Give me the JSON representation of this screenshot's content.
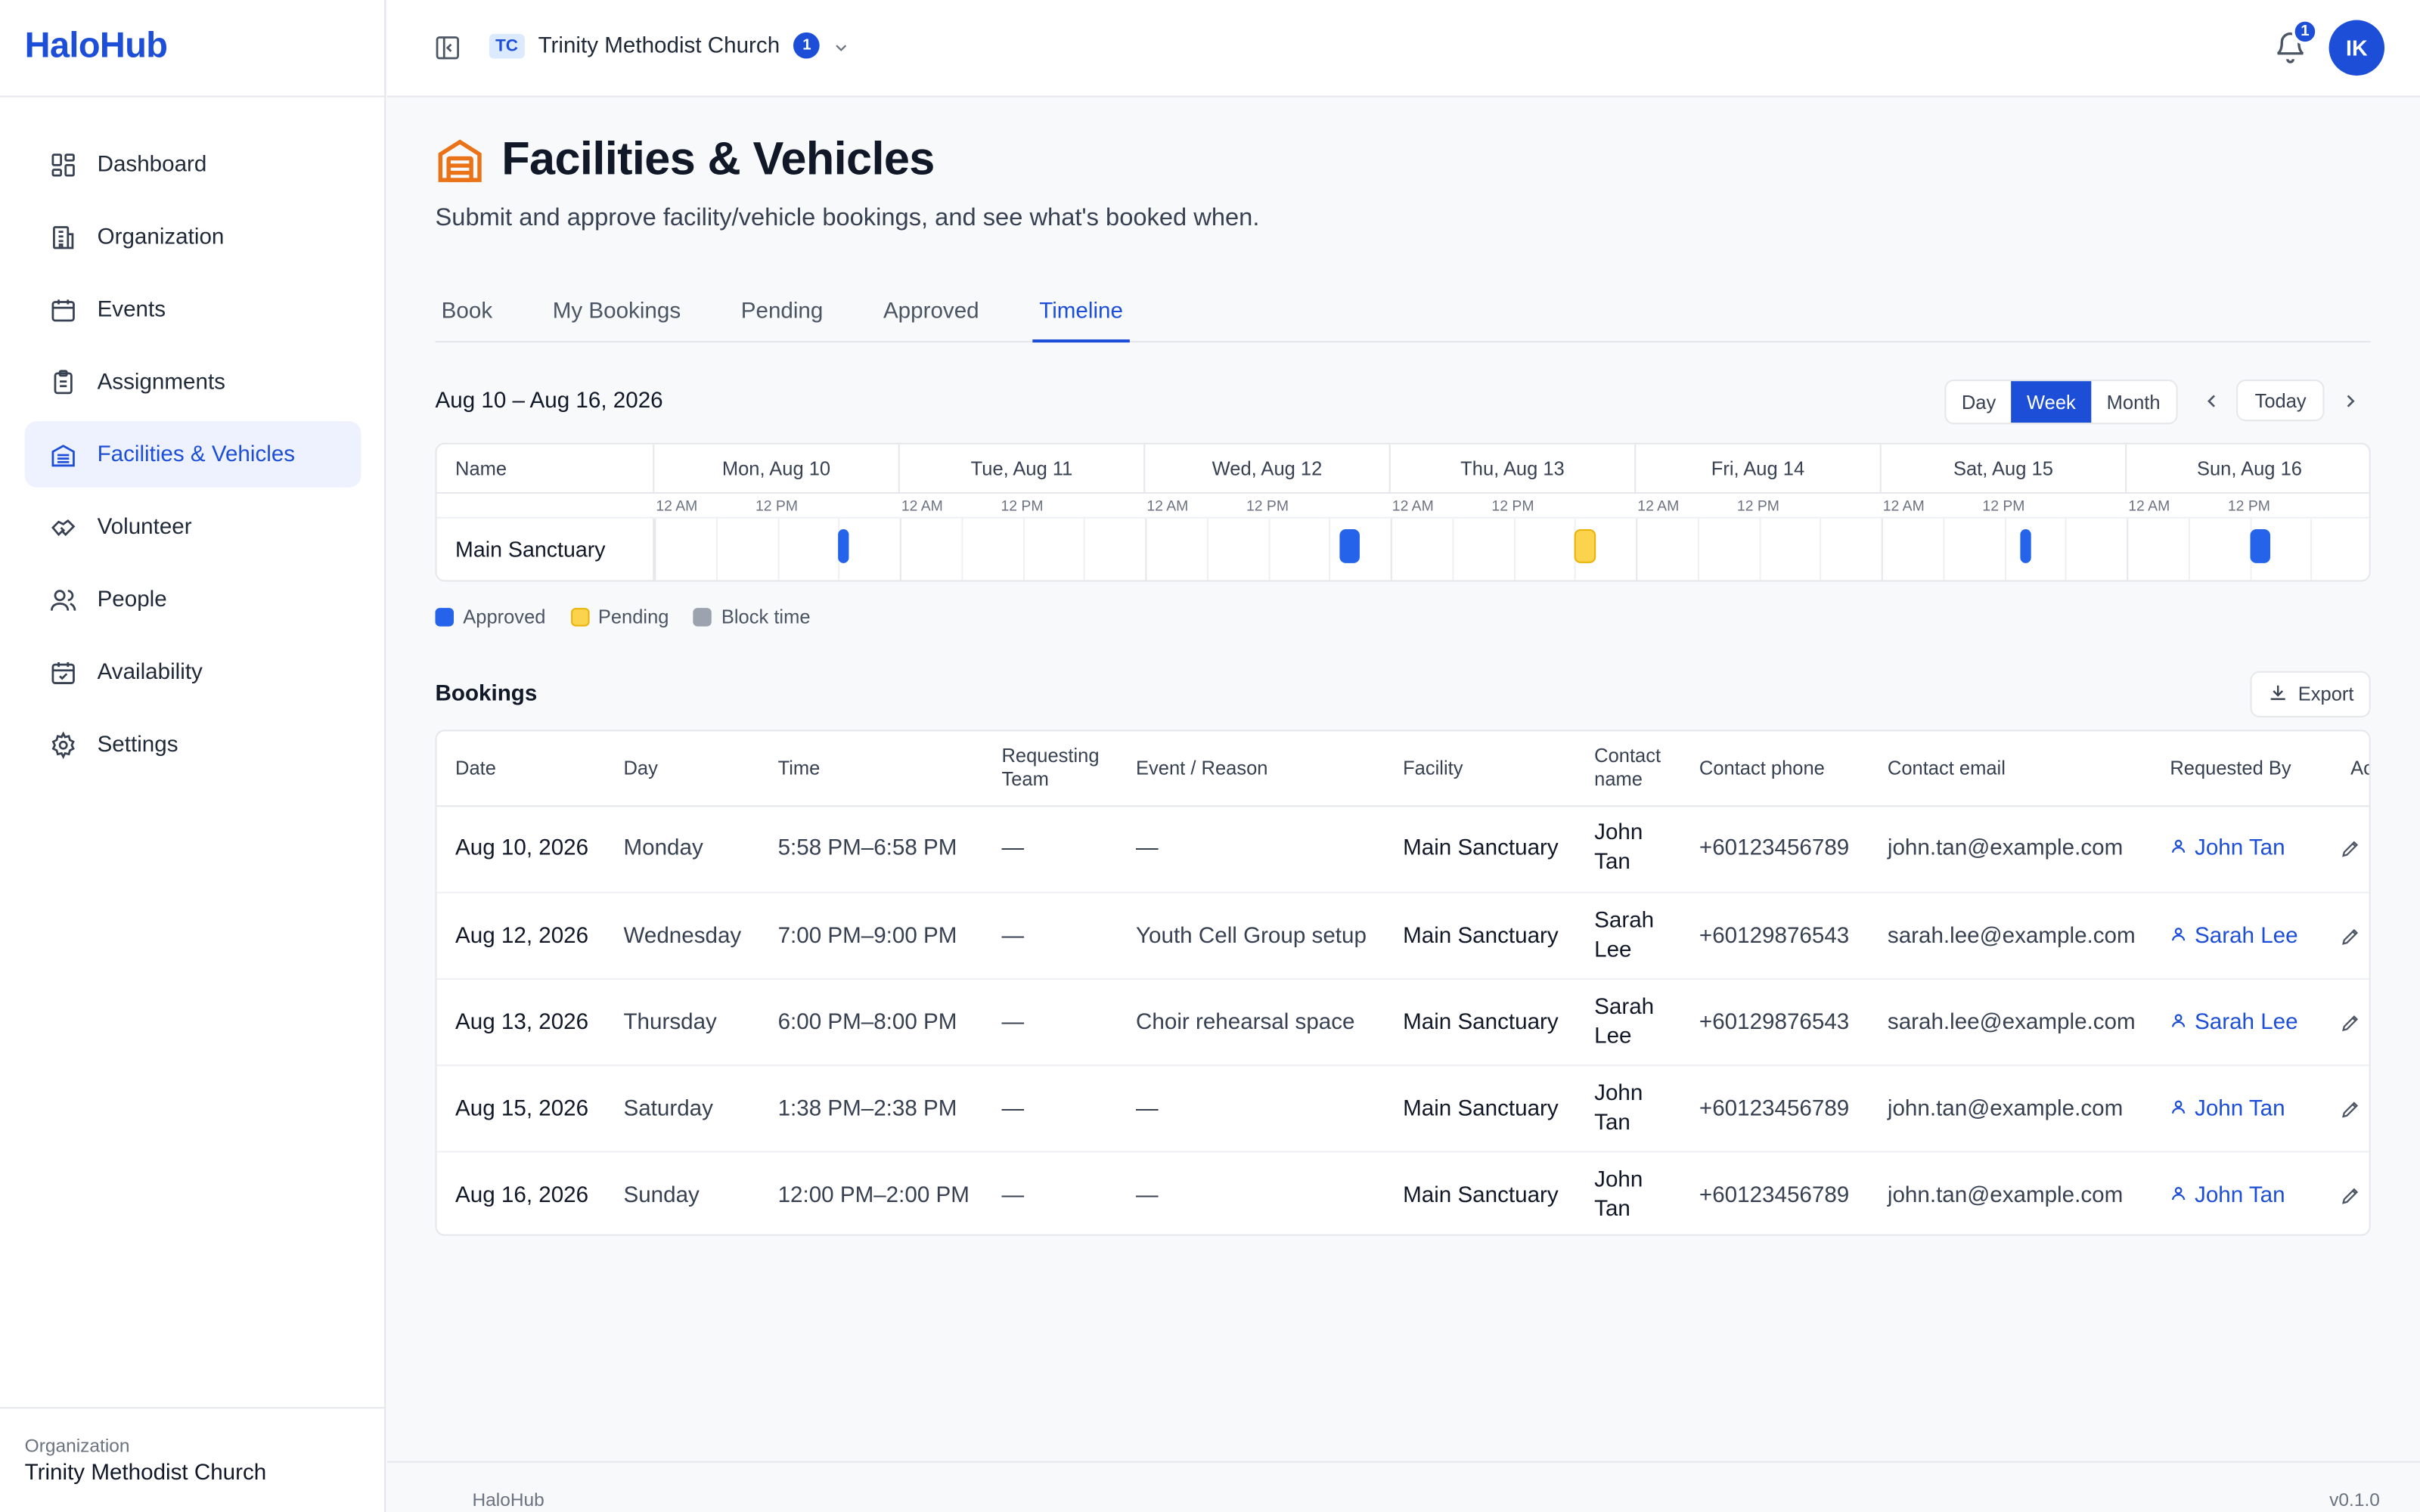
{
  "app": {
    "name": "HaloHub",
    "version": "v0.1.0"
  },
  "sidebar": {
    "items": [
      {
        "label": "Dashboard",
        "icon": "dashboard-icon"
      },
      {
        "label": "Organization",
        "icon": "building-icon"
      },
      {
        "label": "Events",
        "icon": "calendar-icon"
      },
      {
        "label": "Assignments",
        "icon": "clipboard-icon"
      },
      {
        "label": "Facilities & Vehicles",
        "icon": "warehouse-icon",
        "active": true
      },
      {
        "label": "Volunteer",
        "icon": "handshake-icon"
      },
      {
        "label": "People",
        "icon": "users-icon"
      },
      {
        "label": "Availability",
        "icon": "calendar-check-icon"
      },
      {
        "label": "Settings",
        "icon": "gear-icon"
      }
    ],
    "footer": {
      "label": "Organization",
      "value": "Trinity Methodist Church"
    }
  },
  "topbar": {
    "org_initials": "TC",
    "org_name": "Trinity Methodist Church",
    "org_count": "1",
    "notification_count": "1",
    "avatar_initials": "IK"
  },
  "page": {
    "title": "Facilities & Vehicles",
    "subtitle": "Submit and approve facility/vehicle bookings, and see what's booked when.",
    "accent_color": "#1d4ed8",
    "icon_color": "#ea7317"
  },
  "tabs": [
    {
      "label": "Book"
    },
    {
      "label": "My Bookings"
    },
    {
      "label": "Pending"
    },
    {
      "label": "Approved"
    },
    {
      "label": "Timeline",
      "active": true
    }
  ],
  "timeline": {
    "range_label": "Aug 10 – Aug 16, 2026",
    "views": [
      "Day",
      "Week",
      "Month"
    ],
    "active_view": "Week",
    "today_label": "Today",
    "name_header": "Name",
    "days": [
      "Mon, Aug 10",
      "Tue, Aug 11",
      "Wed, Aug 12",
      "Thu, Aug 13",
      "Fri, Aug 14",
      "Sat, Aug 15",
      "Sun, Aug 16"
    ],
    "sub_labels": [
      "12 AM",
      "12 PM"
    ],
    "rows": [
      {
        "name": "Main Sanctuary",
        "bookings": [
          {
            "day": 0,
            "start": 17.97,
            "end": 18.97,
            "status": "approved"
          },
          {
            "day": 2,
            "start": 19,
            "end": 21,
            "status": "approved"
          },
          {
            "day": 3,
            "start": 18,
            "end": 20,
            "status": "pending"
          },
          {
            "day": 5,
            "start": 13.63,
            "end": 14.63,
            "status": "approved"
          },
          {
            "day": 6,
            "start": 12,
            "end": 14,
            "status": "approved"
          }
        ]
      }
    ],
    "legend": [
      {
        "label": "Approved",
        "color": "#2563eb"
      },
      {
        "label": "Pending",
        "color": "#fcd34d"
      },
      {
        "label": "Block time",
        "color": "#9ca3af"
      }
    ]
  },
  "bookings": {
    "title": "Bookings",
    "export_label": "Export",
    "columns": [
      "Date",
      "Day",
      "Time",
      "Requesting Team",
      "Event / Reason",
      "Facility",
      "Contact name",
      "Contact phone",
      "Contact email",
      "Requested By",
      "Ac"
    ],
    "rows": [
      [
        "Aug 10, 2026",
        "Monday",
        "5:58 PM–6:58 PM",
        "—",
        "—",
        "Main Sanctuary",
        "John Tan",
        "+60123456789",
        "john.tan@example.com",
        "John Tan"
      ],
      [
        "Aug 12, 2026",
        "Wednesday",
        "7:00 PM–9:00 PM",
        "—",
        "Youth Cell Group setup",
        "Main Sanctuary",
        "Sarah Lee",
        "+60129876543",
        "sarah.lee@example.com",
        "Sarah Lee"
      ],
      [
        "Aug 13, 2026",
        "Thursday",
        "6:00 PM–8:00 PM",
        "—",
        "Choir rehearsal space",
        "Main Sanctuary",
        "Sarah Lee",
        "+60129876543",
        "sarah.lee@example.com",
        "Sarah Lee"
      ],
      [
        "Aug 15, 2026",
        "Saturday",
        "1:38 PM–2:38 PM",
        "—",
        "—",
        "Main Sanctuary",
        "John Tan",
        "+60123456789",
        "john.tan@example.com",
        "John Tan"
      ],
      [
        "Aug 16, 2026",
        "Sunday",
        "12:00 PM–2:00 PM",
        "—",
        "—",
        "Main Sanctuary",
        "John Tan",
        "+60123456789",
        "john.tan@example.com",
        "John Tan"
      ]
    ]
  },
  "footer": {
    "left": "HaloHub",
    "right": "v0.1.0"
  }
}
